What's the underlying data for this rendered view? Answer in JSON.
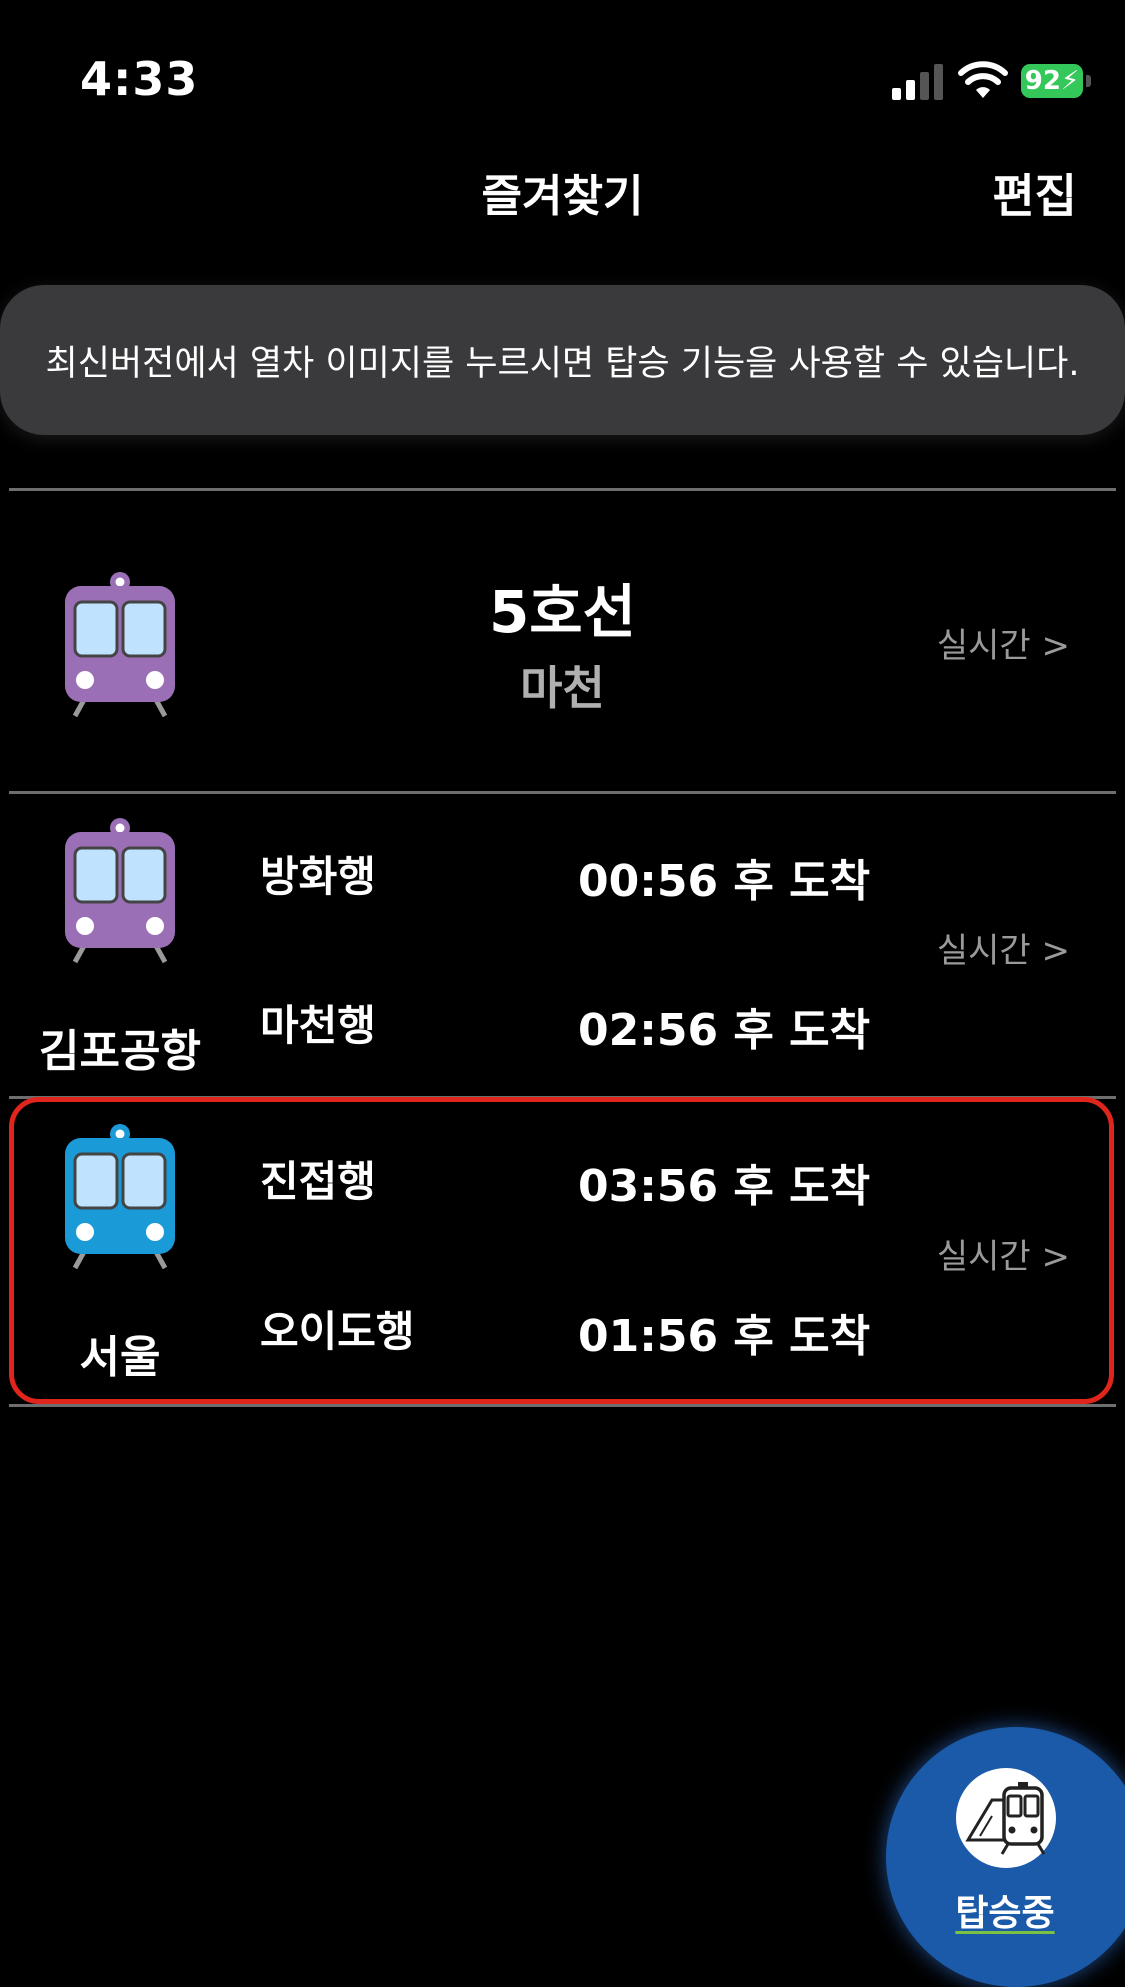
{
  "status_bar": {
    "time": "4:33",
    "battery": "92"
  },
  "nav": {
    "title": "즐겨찾기",
    "edit_label": "편집"
  },
  "notice": {
    "text": "최신버전에서 열차 이미지를 누르시면 탑승 기능을 사용할 수 있습니다."
  },
  "colors": {
    "line5": "#9b6fb6",
    "seoul": "#1a9ad6",
    "highlight": "#e0261c",
    "fab": "#1a5aa8"
  },
  "favorites": [
    {
      "line": "5호선",
      "station": "마천",
      "realtime": "실시간 >"
    },
    {
      "station": "김포공항",
      "realtime": "실시간 >",
      "trains": [
        {
          "destination": "방화행",
          "arrival": "00:56 후 도착"
        },
        {
          "destination": "마천행",
          "arrival": "02:56 후 도착"
        }
      ]
    },
    {
      "station": "서울",
      "realtime": "실시간 >",
      "trains": [
        {
          "destination": "진접행",
          "arrival": "03:56 후 도착"
        },
        {
          "destination": "오이도행",
          "arrival": "01:56 후 도착"
        }
      ]
    }
  ],
  "fab": {
    "label": "탑승중",
    "icon": "train-front-icon"
  }
}
